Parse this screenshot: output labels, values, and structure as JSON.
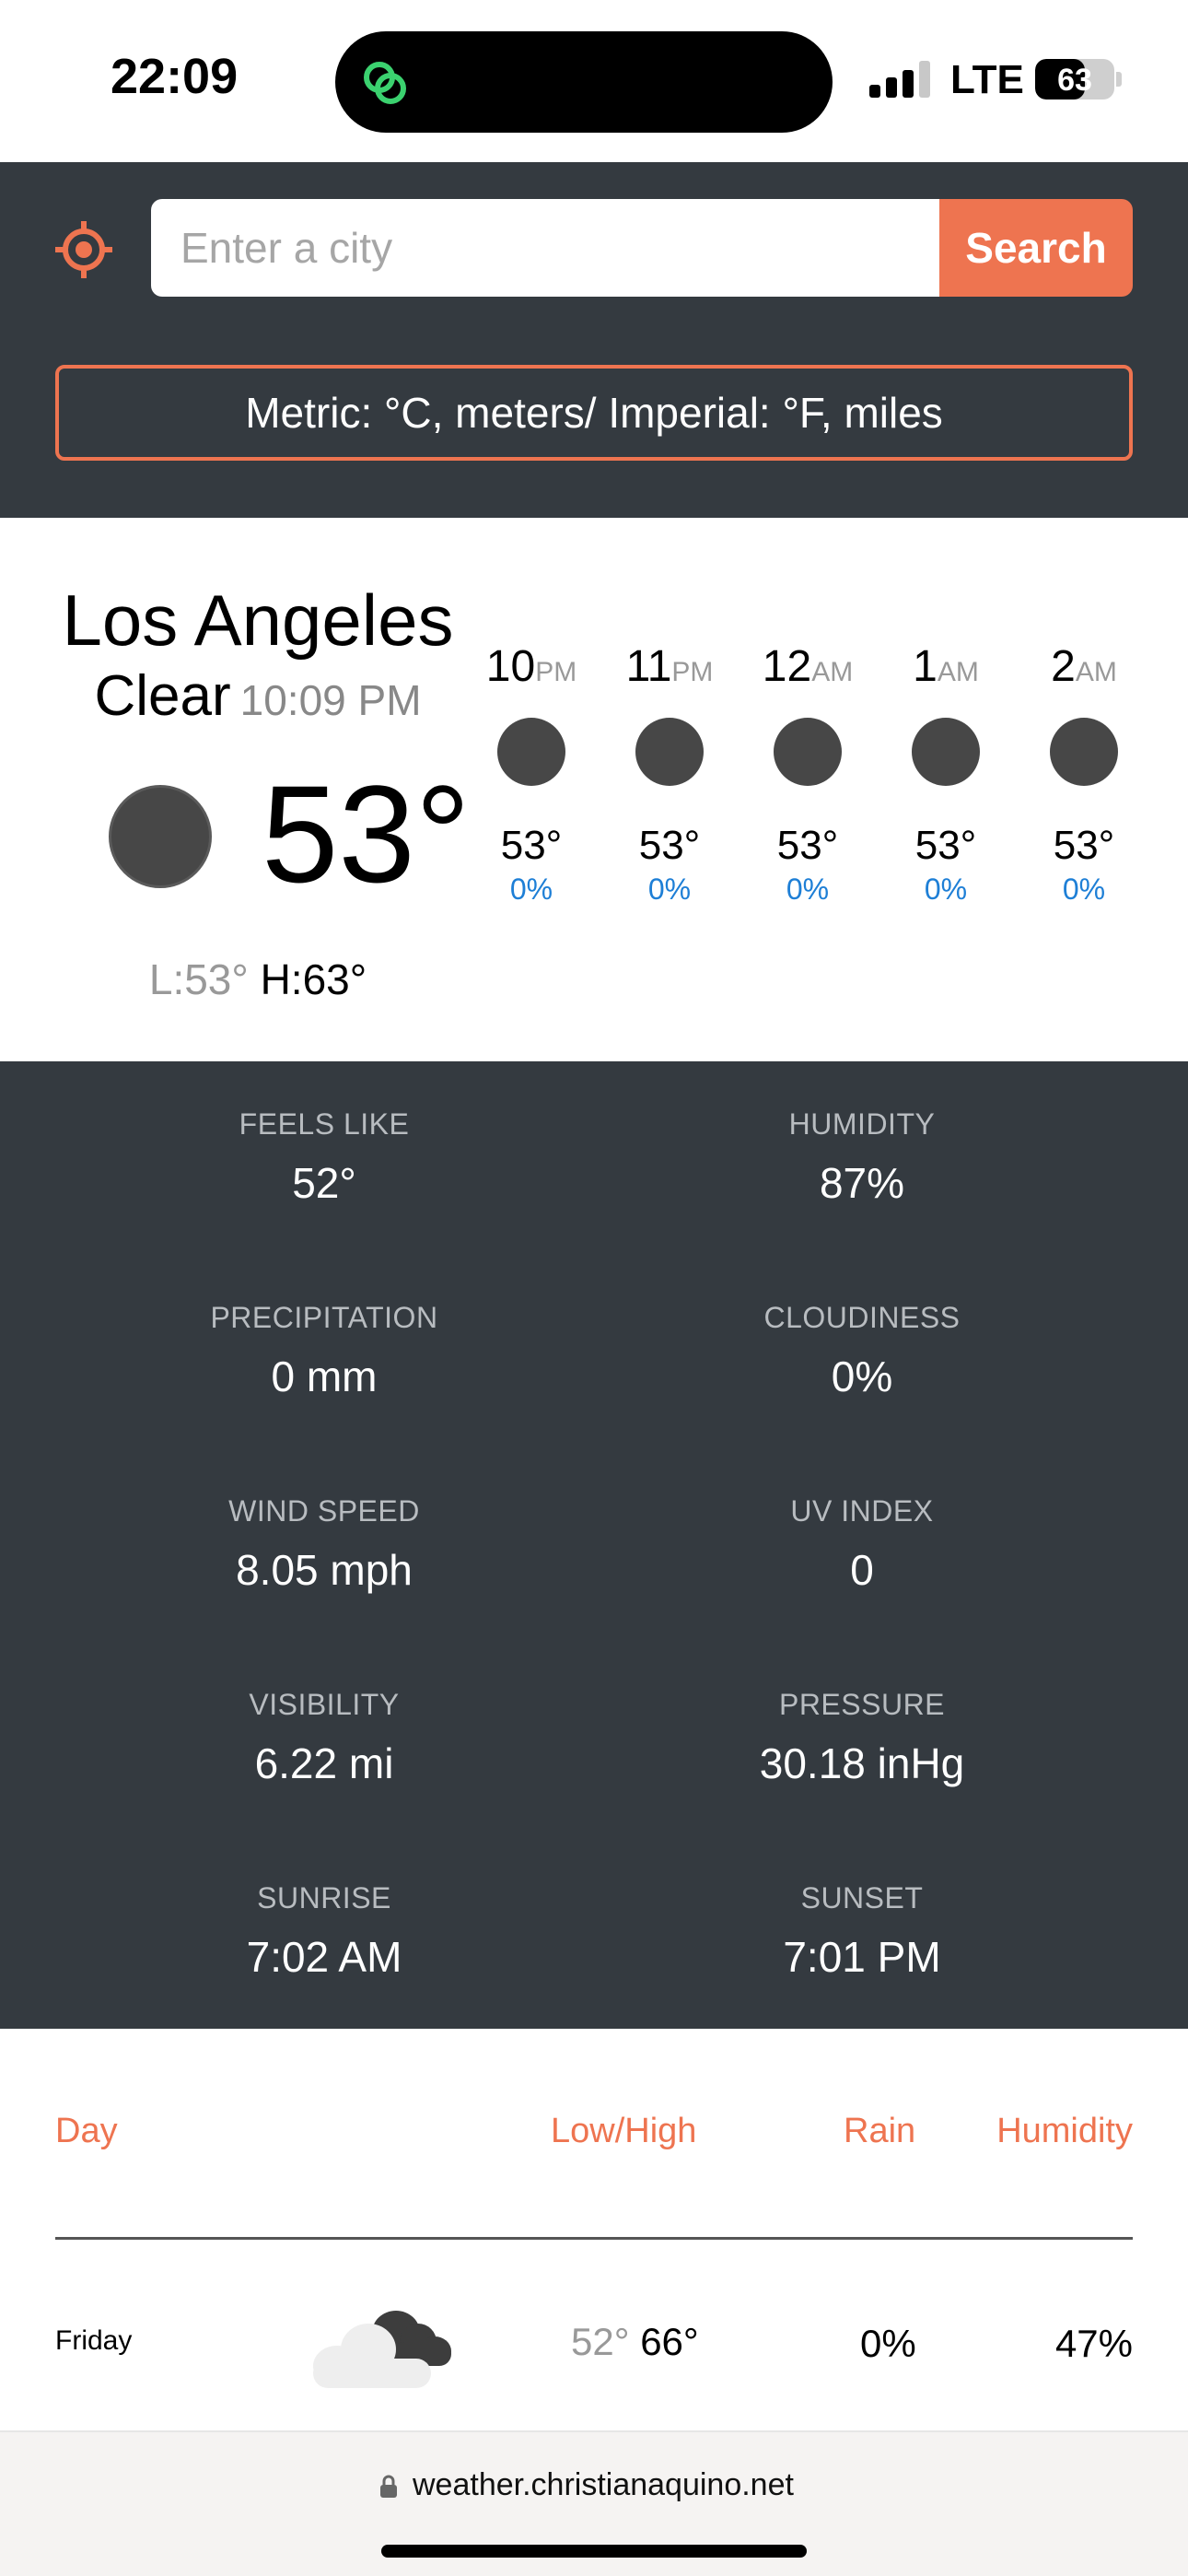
{
  "status_bar": {
    "time": "22:09",
    "network": "LTE",
    "battery": "63",
    "battery_level": 0.63
  },
  "search": {
    "placeholder": "Enter a city",
    "button_label": "Search"
  },
  "units_toggle": "Metric: °C, meters/ Imperial: °F, miles",
  "current": {
    "city": "Los Angeles",
    "condition": "Clear",
    "local_time": "10:09 PM",
    "temperature": "53°",
    "low": "L:53°",
    "high": "H:63°"
  },
  "hourly": [
    {
      "hour": "10",
      "ampm": "PM",
      "temp": "53°",
      "pop": "0%"
    },
    {
      "hour": "11",
      "ampm": "PM",
      "temp": "53°",
      "pop": "0%"
    },
    {
      "hour": "12",
      "ampm": "AM",
      "temp": "53°",
      "pop": "0%"
    },
    {
      "hour": "1",
      "ampm": "AM",
      "temp": "53°",
      "pop": "0%"
    },
    {
      "hour": "2",
      "ampm": "AM",
      "temp": "53°",
      "pop": "0%"
    }
  ],
  "details": [
    {
      "label": "FEELS LIKE",
      "value": "52°"
    },
    {
      "label": "HUMIDITY",
      "value": "87%"
    },
    {
      "label": "PRECIPITATION",
      "value": "0 mm"
    },
    {
      "label": "CLOUDINESS",
      "value": "0%"
    },
    {
      "label": "WIND SPEED",
      "value": "8.05 mph"
    },
    {
      "label": "UV INDEX",
      "value": "0"
    },
    {
      "label": "VISIBILITY",
      "value": "6.22 mi"
    },
    {
      "label": "PRESSURE",
      "value": "30.18 inHg"
    },
    {
      "label": "SUNRISE",
      "value": "7:02 AM"
    },
    {
      "label": "SUNSET",
      "value": "7:01 PM"
    }
  ],
  "forecast": {
    "headers": {
      "day": "Day",
      "lowhigh": "Low/High",
      "rain": "Rain",
      "humidity": "Humidity"
    },
    "rows": [
      {
        "day": "Friday",
        "low": "52°",
        "high": "66°",
        "rain": "0%",
        "humidity": "47%",
        "icon": "cloud-icon"
      }
    ]
  },
  "browser": {
    "url": "weather.christianaquino.net"
  },
  "colors": {
    "accent": "#ee7450",
    "dark_panel": "#343a40",
    "pop_blue": "#1e7fd6",
    "icon_gray": "#474747"
  }
}
